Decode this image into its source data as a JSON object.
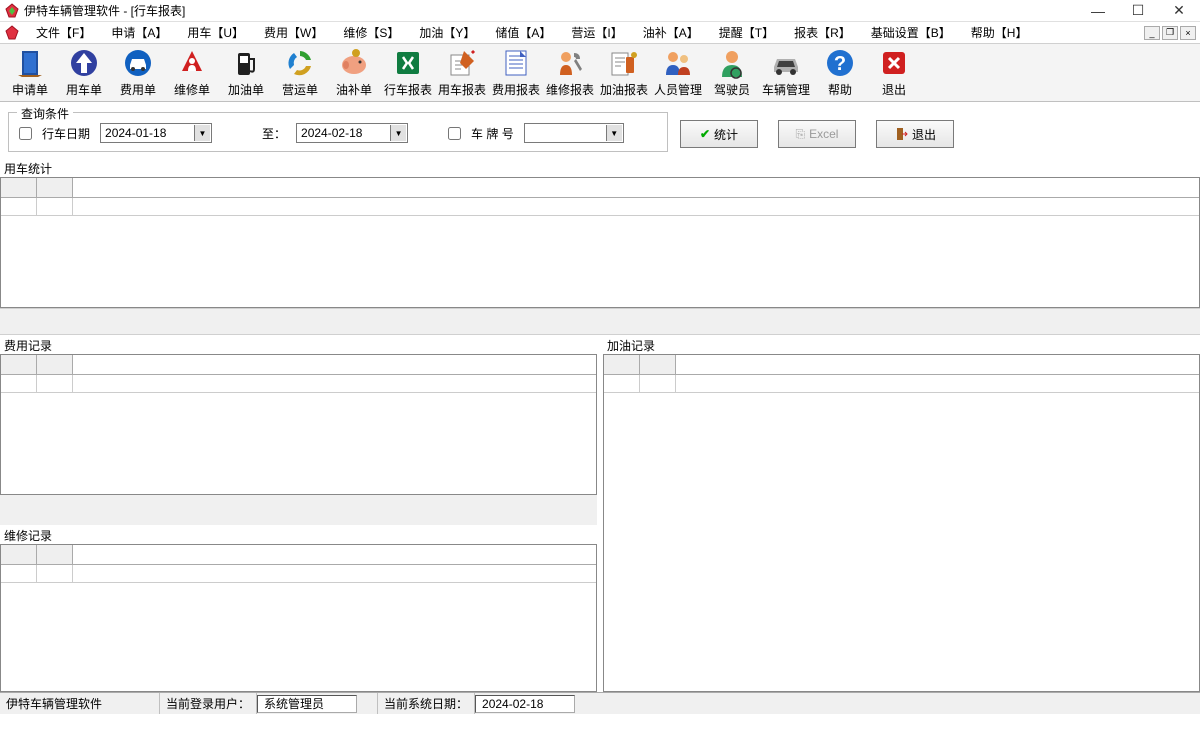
{
  "window": {
    "title": "伊特车辆管理软件 - [行车报表]"
  },
  "menu": {
    "items": [
      "文件【F】",
      "申请【A】",
      "用车【U】",
      "费用【W】",
      "维修【S】",
      "加油【Y】",
      "储值【A】",
      "营运【I】",
      "油补【A】",
      "提醒【T】",
      "报表【R】",
      "基础设置【B】",
      "帮助【H】"
    ]
  },
  "toolbar": {
    "items": [
      {
        "label": "申请单",
        "icon": "door"
      },
      {
        "label": "用车单",
        "icon": "up-arrow"
      },
      {
        "label": "费用单",
        "icon": "car-blue"
      },
      {
        "label": "维修单",
        "icon": "person-red"
      },
      {
        "label": "加油单",
        "icon": "fuel"
      },
      {
        "label": "营运单",
        "icon": "recycle"
      },
      {
        "label": "油补单",
        "icon": "piggy"
      },
      {
        "label": "行车报表",
        "icon": "excel"
      },
      {
        "label": "用车报表",
        "icon": "pen"
      },
      {
        "label": "费用报表",
        "icon": "sheet"
      },
      {
        "label": "维修报表",
        "icon": "wrench-person"
      },
      {
        "label": "加油报表",
        "icon": "fuel-sheet"
      },
      {
        "label": "人员管理",
        "icon": "people"
      },
      {
        "label": "驾驶员",
        "icon": "driver"
      },
      {
        "label": "车辆管理",
        "icon": "car-grey"
      },
      {
        "label": "帮助",
        "icon": "help"
      },
      {
        "label": "退出",
        "icon": "exit"
      }
    ]
  },
  "query": {
    "legend": "查询条件",
    "date_label": "行车日期",
    "date_from": "2024-01-18",
    "to_label": "至：",
    "date_to": "2024-02-18",
    "plate_label": "车 牌 号",
    "plate_value": "",
    "stat_btn": "统计",
    "excel_btn": "Excel",
    "exit_btn": "退出"
  },
  "sections": {
    "usage": "用车统计",
    "expense": "费用记录",
    "fuel": "加油记录",
    "repair": "维修记录"
  },
  "status": {
    "app": "伊特车辆管理软件",
    "user_label": "当前登录用户：",
    "user_value": "系统管理员",
    "date_label": "当前系统日期：",
    "date_value": "2024-02-18"
  }
}
